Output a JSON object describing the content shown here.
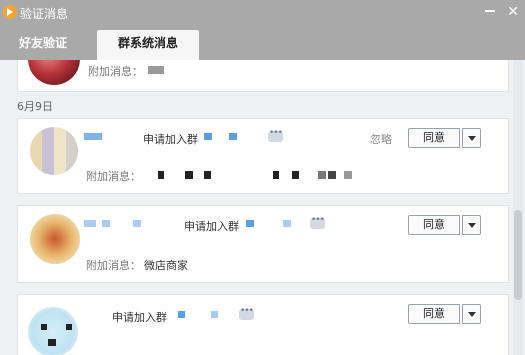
{
  "window": {
    "title": "验证消息"
  },
  "tabs": [
    {
      "label": "好友验证"
    },
    {
      "label": "群系统消息"
    }
  ],
  "list": {
    "date_header": "6月9日",
    "extra_label": "附加消息：",
    "request_text": "申请加入群",
    "ignore_label": "忽略",
    "agree_label": "同意",
    "message_3": "微店商家"
  }
}
